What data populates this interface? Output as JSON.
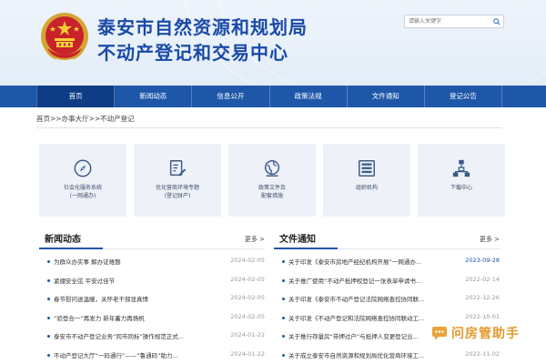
{
  "header": {
    "title_line1": "泰安市自然资源和规划局",
    "title_line2": "不动产登记和交易中心",
    "search_placeholder": "请输入关键字"
  },
  "nav": {
    "items": [
      "首页",
      "新闻动态",
      "信息公开",
      "政策法规",
      "文件通知",
      "登记公告"
    ],
    "active": "首页"
  },
  "breadcrumb": "首页>>办事大厅>>不动产登记",
  "services": [
    {
      "icon": "compass-icon",
      "line1": "社会化服务系统",
      "line2": "(一网通办)"
    },
    {
      "icon": "edit-document-icon",
      "line1": "优化营商环境专题",
      "line2": "(登记财产)"
    },
    {
      "icon": "globe-icon",
      "line1": "政策文件及",
      "line2": "配套措施"
    },
    {
      "icon": "archive-icon",
      "line1": "组织机构",
      "line2": ""
    },
    {
      "icon": "org-chart-icon",
      "line1": "下载中心",
      "line2": ""
    }
  ],
  "news": {
    "title": "新闻动态",
    "more": "更多 >",
    "items": [
      {
        "title": "为群众办实事 解办证难题",
        "date": "2024-02-05"
      },
      {
        "title": "紧绷安全弦 平安过佳节",
        "date": "2024-02-05"
      },
      {
        "title": "春节慰问送温暖，关怀老干部显真情",
        "date": "2024-02-05"
      },
      {
        "title": "“验登合一”再发力 新年蓄力再扬帆",
        "date": "2024-02-05"
      },
      {
        "title": "泰安市不动产登记业务“同市同标”操作规范正式...",
        "date": "2024-01-22"
      },
      {
        "title": "不动产登记大厅“一码通行”——“鲁通码”助力...",
        "date": "2024-01-22"
      }
    ]
  },
  "notices": {
    "title": "文件通知",
    "more": "更多 >",
    "items": [
      {
        "title": "关于印发《泰安市房地产经纪机构开展“一网通办...",
        "date": "2023-09-28",
        "highlight": true
      },
      {
        "title": "关于推广使用“不动产抵押权登记一张表单申请书...",
        "date": "2022-02-14",
        "highlight": false
      },
      {
        "title": "关于印发《泰安市不动产登记法院网络查控协同联...",
        "date": "2022-12-26",
        "highlight": false
      },
      {
        "title": "关于印发《不动产登记和法院网络查控协同联动工...",
        "date": "2022-10-01",
        "highlight": false
      },
      {
        "title": "关于推行存量房“带押过户”与抵押人变更登记业...",
        "date": "2022-11-28",
        "highlight": false
      },
      {
        "title": "关于成立泰安市自然资源和规划局优化营商环境工...",
        "date": "2022-11-02",
        "highlight": false
      }
    ]
  },
  "watermark": "问房管助手",
  "colors": {
    "brand": "#1e57a8",
    "title": "#1a4aa8",
    "highlight_date": "#1e57a8"
  }
}
